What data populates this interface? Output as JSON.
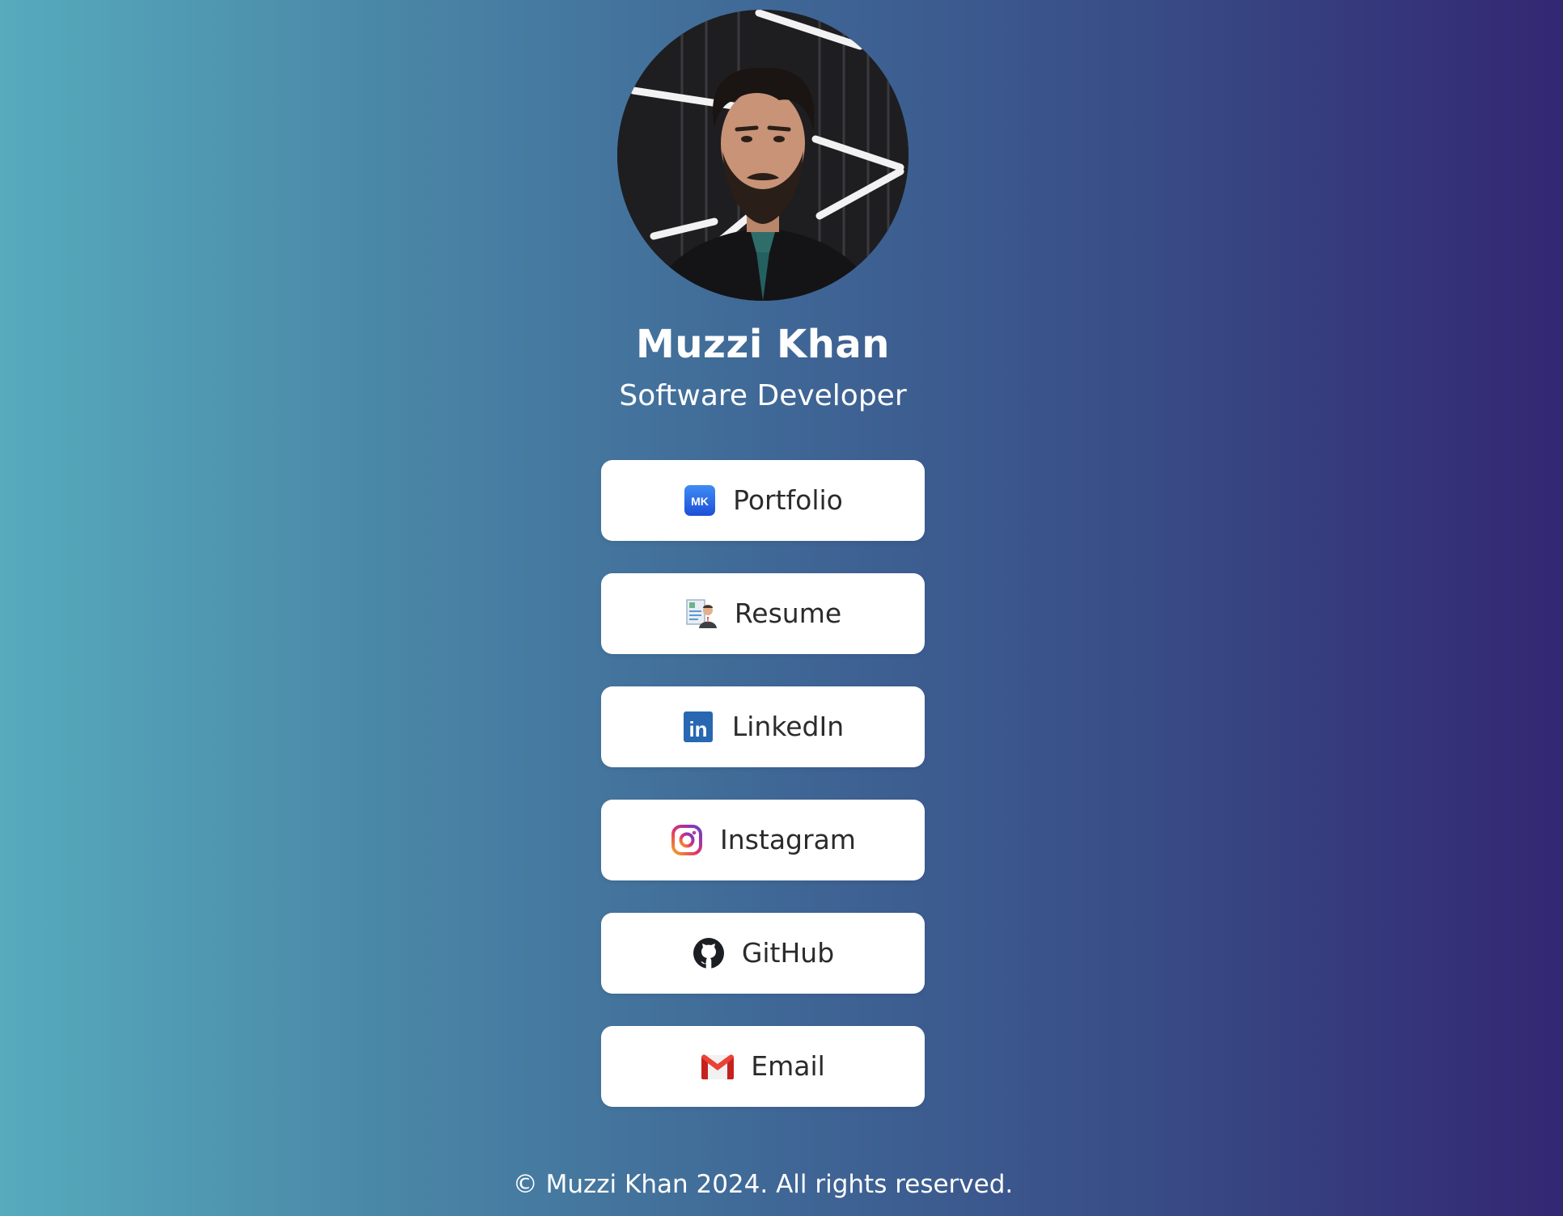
{
  "profile": {
    "name": "Muzzi Khan",
    "title": "Software Developer"
  },
  "links": [
    {
      "label": "Portfolio",
      "icon": "portfolio-mk-icon"
    },
    {
      "label": "Resume",
      "icon": "resume-icon"
    },
    {
      "label": "LinkedIn",
      "icon": "linkedin-icon"
    },
    {
      "label": "Instagram",
      "icon": "instagram-icon"
    },
    {
      "label": "GitHub",
      "icon": "github-icon"
    },
    {
      "label": "Email",
      "icon": "gmail-icon"
    }
  ],
  "icon_text": {
    "portfolio": "MK",
    "linkedin": "in"
  },
  "footer": {
    "text": "© Muzzi Khan 2024. All rights reserved."
  },
  "colors": {
    "gradient_left": "#56abbd",
    "gradient_right": "#332773",
    "button_bg": "#ffffff",
    "button_text": "#2b2b2b"
  }
}
